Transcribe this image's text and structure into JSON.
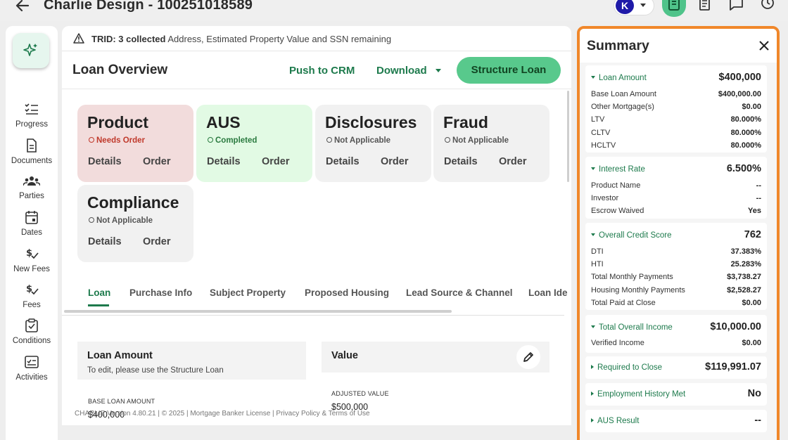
{
  "header": {
    "title": "Charlie Design - 100251018589",
    "user_initial": "K"
  },
  "nav": [
    {
      "label": "Progress"
    },
    {
      "label": "Documents"
    },
    {
      "label": "Parties"
    },
    {
      "label": "Dates"
    },
    {
      "label": "New Fees"
    },
    {
      "label": "Fees"
    },
    {
      "label": "Conditions"
    },
    {
      "label": "Activities"
    }
  ],
  "trid": {
    "prefix": "TRID: 3 collected",
    "text": " Address, Estimated Property Value and SSN remaining"
  },
  "overview": {
    "title": "Loan Overview",
    "push_label": "Push to CRM",
    "download_label": "Download",
    "structure_label": "Structure Loan"
  },
  "cards": [
    {
      "title": "Product",
      "status": "Needs Order",
      "details": "Details",
      "order": "Order",
      "tone": "red"
    },
    {
      "title": "AUS",
      "status": "Completed",
      "details": "Details",
      "order": "Order",
      "tone": "green"
    },
    {
      "title": "Disclosures",
      "status": "Not Applicable",
      "details": "Details",
      "order": "Order",
      "tone": "neutral"
    },
    {
      "title": "Fraud",
      "status": "Not Applicable",
      "details": "Details",
      "order": "Order",
      "tone": "neutral"
    },
    {
      "title": "Compliance",
      "status": "Not Applicable",
      "details": "Details",
      "order": "Order",
      "tone": "neutral"
    }
  ],
  "tabs": [
    "Loan",
    "Purchase Info",
    "Subject Property",
    "Proposed Housing",
    "Lead Source & Channel",
    "Loan Ide"
  ],
  "loan_amount_section": {
    "title": "Loan Amount",
    "subtitle": "To edit, please use the Structure Loan",
    "field_label": "BASE LOAN AMOUNT",
    "field_value": "$400,000"
  },
  "value_section": {
    "title": "Value",
    "field_label": "ADJUSTED VALUE",
    "field_value": "$500,000"
  },
  "footer": "CHARLIE   Version 4.80.21   |   © 2025 | Mortgage Banker License   |   Privacy Policy & Terms of Use",
  "summary": {
    "title": "Summary",
    "loan_amount": {
      "label": "Loan Amount",
      "value": "$400,000",
      "rows": [
        [
          "Base Loan Amount",
          "$400,000.00"
        ],
        [
          "Other Mortgage(s)",
          "$0.00"
        ],
        [
          "LTV",
          "80.000%"
        ],
        [
          "CLTV",
          "80.000%"
        ],
        [
          "HCLTV",
          "80.000%"
        ]
      ]
    },
    "interest_rate": {
      "label": "Interest Rate",
      "value": "6.500%",
      "rows": [
        [
          "Product Name",
          "--"
        ],
        [
          "Investor",
          "--"
        ],
        [
          "Escrow Waived",
          "Yes"
        ]
      ]
    },
    "credit_score": {
      "label": "Overall Credit Score",
      "value": "762",
      "rows": [
        [
          "DTI",
          "37.383%"
        ],
        [
          "HTI",
          "25.283%"
        ],
        [
          "Total Monthly Payments",
          "$3,738.27"
        ],
        [
          "Housing Monthly Payments",
          "$2,528.27"
        ],
        [
          "Total Paid at Close",
          "$0.00"
        ]
      ]
    },
    "income": {
      "label": "Total Overall Income",
      "value": "$10,000.00",
      "rows": [
        [
          "Verified Income",
          "$0.00"
        ]
      ]
    },
    "required_to_close": {
      "label": "Required to Close",
      "value": "$119,991.07"
    },
    "employment": {
      "label": "Employment History Met",
      "value": "No"
    },
    "aus_result": {
      "label": "AUS Result",
      "value": "--"
    }
  }
}
